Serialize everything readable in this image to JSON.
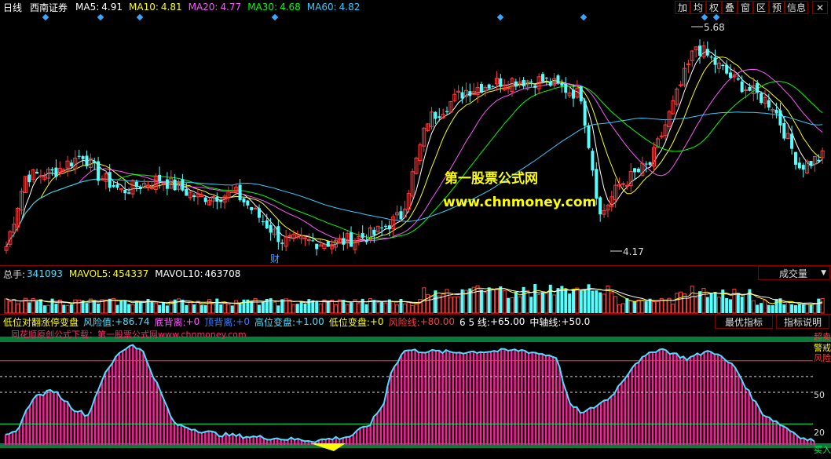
{
  "colors": {
    "up": "#ff3b3b",
    "down": "#54ffff",
    "ma5": "#ffffff",
    "ma10": "#ffff00",
    "ma20": "#ff55ff",
    "ma30": "#00ff00",
    "ma60": "#33ccff",
    "risk": "#ff1e9e",
    "risk_line": "#4ae0ff",
    "watermark": "#ffff00"
  },
  "header": {
    "period": "日线",
    "stock": "西南证券",
    "ma": [
      {
        "label": "MA5:",
        "value": "4.91"
      },
      {
        "label": "MA10:",
        "value": "4.81"
      },
      {
        "label": "MA20:",
        "value": "4.77"
      },
      {
        "label": "MA30:",
        "value": "4.68"
      },
      {
        "label": "MA60:",
        "value": "4.82"
      }
    ],
    "buttons": [
      "加",
      "均",
      "权",
      "叠",
      "窗",
      "区",
      "预",
      "信息"
    ]
  },
  "price_panel": {
    "high_label": "5.68",
    "low_label": "4.17",
    "cai_label": "财",
    "watermark_title": "第一股票公式网",
    "watermark_url": "www.chnmoney.com"
  },
  "volume_panel": {
    "items": [
      {
        "label": "总手:",
        "value": "341093"
      },
      {
        "label": "MAVOL5:",
        "value": "454337"
      },
      {
        "label": "MAVOL10:",
        "value": "463708"
      }
    ],
    "dropdown": "成交量",
    "dropdown_arrow": "▼"
  },
  "indicator_panel": {
    "title": "低位对翻涨停变盘",
    "items": [
      {
        "label": "风险值:",
        "value": "+86.74"
      },
      {
        "label": "底背离:",
        "value": "+0"
      },
      {
        "label": "顶背离:",
        "value": "+0"
      },
      {
        "label": "高位变盘:",
        "value": "+1.00"
      },
      {
        "label": "低位变盘:",
        "value": "+0"
      },
      {
        "label": "风险线:",
        "value": "+80.00"
      },
      {
        "label": "6 5 线:",
        "value": "+65.00"
      },
      {
        "label": "中轴线:",
        "value": "+50.0"
      }
    ],
    "tab_best": "最优指标",
    "tab_desc": "指标说明",
    "sub_watermark": "同花顺原创公式下载：第一股票公式网www.chnmoney.com",
    "right_labels": [
      "超卖",
      "警戒",
      "风险",
      "50",
      "20",
      "买入"
    ]
  },
  "chart_data": {
    "type": "candlestick",
    "price_axis": {
      "high_marker": 5.68,
      "low_marker": 4.17
    },
    "ma_last": {
      "MA5": 4.91,
      "MA10": 4.81,
      "MA20": 4.77,
      "MA30": 4.68,
      "MA60": 4.82
    },
    "volume_last": {
      "total": 341093,
      "MAVOL5": 454337,
      "MAVOL10": 463708
    },
    "indicator_levels": {
      "risk_line": 80,
      "line_65": 65,
      "mid_line": 50,
      "buy_line": 20
    },
    "risk_value_last": 86.74
  }
}
